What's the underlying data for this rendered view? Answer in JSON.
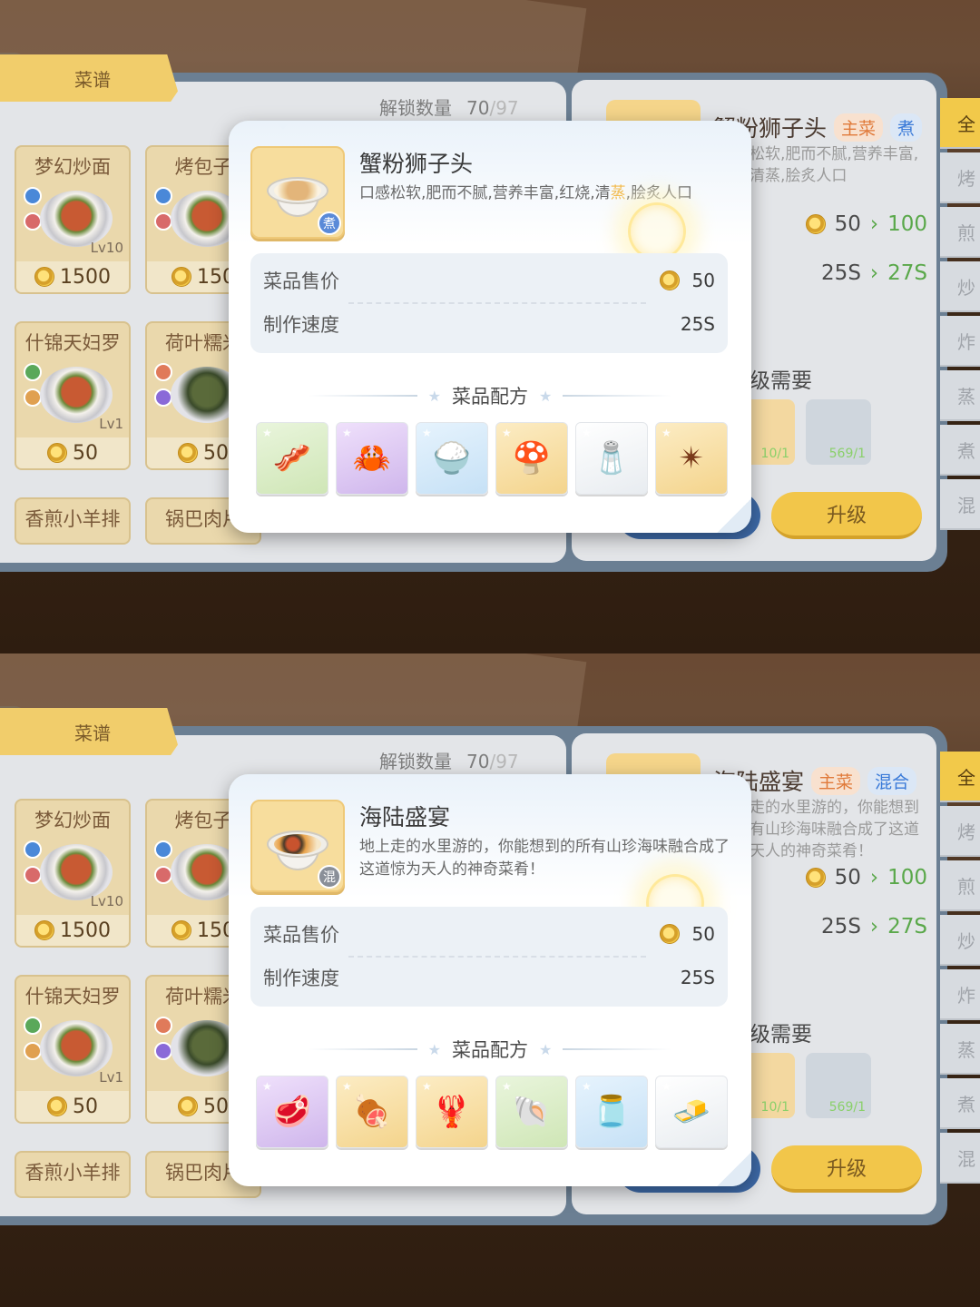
{
  "colors": {
    "accent": "#f2c94a",
    "board": "#6b7f93",
    "price_green": "#5aa84a"
  },
  "panels": [
    {
      "recipe_tab": "菜谱",
      "unlock": {
        "label": "解锁数量",
        "current": "70",
        "total": "/97"
      },
      "cards": [
        {
          "name": "梦幻炒面",
          "level": "Lv10",
          "price": "1500"
        },
        {
          "name": "烤包子",
          "level": "L",
          "price": "150"
        },
        {
          "name": "什锦天妇罗",
          "level": "Lv1",
          "price": "50"
        },
        {
          "name": "荷叶糯米",
          "level": "",
          "price": "50"
        },
        {
          "name": "香煎小羊排",
          "level": "",
          "price": ""
        },
        {
          "name": "锅巴肉片",
          "level": "",
          "price": ""
        }
      ],
      "category_tabs": [
        "全",
        "烤",
        "煎",
        "炒",
        "炸",
        "蒸",
        "煮",
        "混"
      ],
      "detail": {
        "name": "蟹粉狮子头",
        "badge_main": "主菜",
        "badge_cat": "煮",
        "desc": "松软,肥而不腻,营养丰富,清蒸,脍炙人口",
        "price_from": "50",
        "price_to": "100",
        "speed_from": "25S",
        "speed_to": "27S",
        "need_label": "级需要",
        "slot1": "10/1",
        "slot2": "569/1",
        "upgrade": "升级"
      },
      "popup": {
        "title": "蟹粉狮子头",
        "desc_a": "口感松软,肥而不腻,营养丰富,红烧,清",
        "desc_b": "蒸",
        "desc_c": ",脍炙人口",
        "method_tag": "煮",
        "price_label": "菜品售价",
        "price_value": "50",
        "speed_label": "制作速度",
        "speed_value": "25S",
        "recipe_label": "菜品配方",
        "ingredients": [
          {
            "name": "pork-belly",
            "icon": "🥓"
          },
          {
            "name": "crab",
            "icon": "🦀"
          },
          {
            "name": "flour",
            "icon": "🍚"
          },
          {
            "name": "mushroom",
            "icon": "🍄"
          },
          {
            "name": "salt",
            "icon": "🧂"
          },
          {
            "name": "star-anise",
            "icon": "✴"
          }
        ]
      }
    },
    {
      "recipe_tab": "菜谱",
      "unlock": {
        "label": "解锁数量",
        "current": "70",
        "total": "/97"
      },
      "cards": [
        {
          "name": "梦幻炒面",
          "level": "Lv10",
          "price": "1500"
        },
        {
          "name": "烤包子",
          "level": "L",
          "price": "150"
        },
        {
          "name": "什锦天妇罗",
          "level": "Lv1",
          "price": "50"
        },
        {
          "name": "荷叶糯米",
          "level": "",
          "price": "50"
        },
        {
          "name": "香煎小羊排",
          "level": "",
          "price": ""
        },
        {
          "name": "锅巴肉片",
          "level": "",
          "price": ""
        }
      ],
      "category_tabs": [
        "全",
        "烤",
        "煎",
        "炒",
        "炸",
        "蒸",
        "煮",
        "混"
      ],
      "detail": {
        "name": "海陆盛宴",
        "badge_main": "主菜",
        "badge_cat": "混合",
        "desc": "走的水里游的，你能想到有山珍海味融合成了这道天人的神奇菜肴！",
        "price_from": "50",
        "price_to": "100",
        "speed_from": "25S",
        "speed_to": "27S",
        "need_label": "级需要",
        "slot1": "10/1",
        "slot2": "569/1",
        "upgrade": "升级"
      },
      "popup": {
        "title": "海陆盛宴",
        "desc_a": "地上走的水里游的，你能想到的所有山珍海味融合成了这道惊为天人的神奇菜肴！",
        "desc_b": "",
        "desc_c": "",
        "method_tag": "混",
        "price_label": "菜品售价",
        "price_value": "50",
        "speed_label": "制作速度",
        "speed_value": "25S",
        "recipe_label": "菜品配方",
        "ingredients": [
          {
            "name": "meat-steak",
            "icon": "🥩"
          },
          {
            "name": "ribs",
            "icon": "🍖"
          },
          {
            "name": "crayfish",
            "icon": "🦞"
          },
          {
            "name": "clams",
            "icon": "🐚"
          },
          {
            "name": "sauce-jar",
            "icon": "🫙"
          },
          {
            "name": "butter",
            "icon": "🧈"
          }
        ]
      }
    }
  ]
}
